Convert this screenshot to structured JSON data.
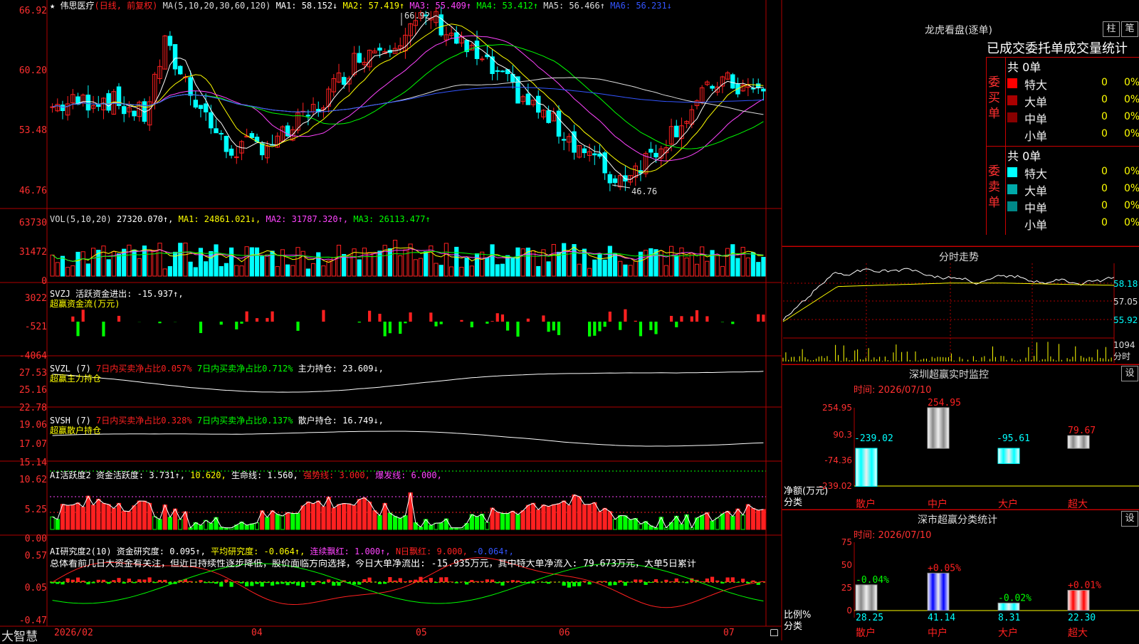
{
  "app": {
    "brand": "大智慧"
  },
  "header": {
    "star": "★",
    "stock": "伟思医疗",
    "mode": "(日线, 前复权)",
    "ma_label": "MA(5,10,20,30,60,120)",
    "ma": [
      {
        "t": "MA1: 58.152↓",
        "c": "#ffffff"
      },
      {
        "t": "MA2: 57.419↑",
        "c": "#ffff00"
      },
      {
        "t": "MA3: 55.409↑",
        "c": "#ff44ff"
      },
      {
        "t": "MA4: 53.412↑",
        "c": "#00ff00"
      },
      {
        "t": "MA5: 56.466↑",
        "c": "#dddddd"
      },
      {
        "t": "MA6: 56.231↓",
        "c": "#3355ff"
      }
    ]
  },
  "price_axis": [
    "66.92",
    "60.20",
    "53.48",
    "46.76"
  ],
  "price_annot": {
    "high": "66.92",
    "low": "46.76"
  },
  "vol": {
    "label": "VOL(5,10,20)",
    "val": "27320.070↑,",
    "ma1": "MA1: 24861.021↓,",
    "ma2": "MA2: 31787.320↑,",
    "ma3": "MA3: 26113.477↑",
    "axis": [
      "63730",
      "31472",
      "0"
    ]
  },
  "svzj": {
    "label": "SVZJ  活跃资金进出: -15.937↑,",
    "sub": "超赢资金流(万元)",
    "axis": [
      "3022",
      "-521",
      "-4064"
    ]
  },
  "svzl": {
    "label": "SVZL (7)",
    "p1": "7日内买卖净占比0.057%",
    "p2": "7日内买卖净占比0.712%",
    "p3": "主力持仓: 23.609↓,",
    "sub": "超赢主力持仓",
    "axis": [
      "27.53",
      "25.16",
      "22.78"
    ]
  },
  "svsh": {
    "label": "SVSH (7)",
    "p1": "7日内买卖净占比0.328%",
    "p2": "7日内买卖净占比0.137%",
    "p3": "散户持仓: 16.749↓,",
    "sub": "超赢散户持仓",
    "axis": [
      "19.06",
      "17.07",
      "15.14"
    ]
  },
  "ai1": {
    "label": "AI活跃度2 资金活跃度: 3.731↑,",
    "v2": "10.620,",
    "v3": "生命线: 1.560,",
    "v4": "强势线: 3.000,",
    "v5": "爆发线: 6.000,",
    "axis": [
      "10.62",
      "5.25",
      "0.00"
    ]
  },
  "ai2": {
    "label": "AI研究度2(10) 资金研究度: 0.095↑,",
    "v2": "平均研究度: -0.064↑,",
    "v3": "连续飘红: 1.000↑,",
    "v4": "N日飘红: 9.000,",
    "v5": "-0.064↑,",
    "text": "总体看前几日大资金有关注，但近日持续性逐步降低，股价面临方向选择，今日大单净流出: -15.935万元，其中特大单净流入: 79.673万元，大单5日累计",
    "axis": [
      "0.57",
      "0.05",
      "-0.47"
    ]
  },
  "dates": [
    "2026/02",
    "04",
    "05",
    "06",
    "07"
  ],
  "lhb": {
    "title": "龙虎看盘(逐单)",
    "btn1": "柱",
    "btn2": "笔",
    "subtitle": "已成交委托单成交量统计",
    "buy": {
      "side": "委买单",
      "total": "共 0单",
      "rows": [
        {
          "k": "特大",
          "v": "0",
          "p": "0%",
          "c": "#ff0000"
        },
        {
          "k": "大单",
          "v": "0",
          "p": "0%",
          "c": "#aa0000"
        },
        {
          "k": "中单",
          "v": "0",
          "p": "0%",
          "c": "#880000"
        },
        {
          "k": "小单",
          "v": "0",
          "p": "0%",
          "c": "#000000"
        }
      ]
    },
    "sell": {
      "side": "委卖单",
      "total": "共 0单",
      "rows": [
        {
          "k": "特大",
          "v": "0",
          "p": "0%",
          "c": "#00ffff"
        },
        {
          "k": "大单",
          "v": "0",
          "p": "0%",
          "c": "#00aaaa"
        },
        {
          "k": "中单",
          "v": "0",
          "p": "0%",
          "c": "#008888"
        },
        {
          "k": "小单",
          "v": "0",
          "p": "0%",
          "c": "#000000"
        }
      ]
    }
  },
  "intraday": {
    "title": "分时走势",
    "axis": [
      "58.18",
      "57.05",
      "55.92"
    ],
    "vol": "1094",
    "vol_label": "分时"
  },
  "sz_monitor": {
    "title": "深圳超赢实时监控",
    "btn": "设",
    "time": "时间: 2026/07/10",
    "axis": [
      "254.95",
      "90.3",
      "-74.36",
      "-239.02"
    ],
    "unit": "净额(万元)",
    "cls": "分类",
    "bars": [
      {
        "name": "散户",
        "val": "-239.02"
      },
      {
        "name": "中户",
        "val": "254.95"
      },
      {
        "name": "大户",
        "val": "-95.61"
      },
      {
        "name": "超大",
        "val": "79.67"
      }
    ]
  },
  "sz_stats": {
    "title": "深市超赢分类统计",
    "btn": "设",
    "time": "时间: 2026/07/10",
    "axis": [
      "75",
      "50",
      "25",
      "0"
    ],
    "unit": "比例%",
    "cls": "分类",
    "bars": [
      {
        "name": "散户",
        "val": "28.25",
        "chg": "-0.04%"
      },
      {
        "name": "中户",
        "val": "41.14",
        "chg": "+0.05%"
      },
      {
        "name": "大户",
        "val": "8.31",
        "chg": "-0.02%"
      },
      {
        "name": "超大",
        "val": "22.30",
        "chg": "+0.01%"
      }
    ]
  },
  "colors": {
    "up": "#ff2020",
    "down": "#00ffff",
    "grid": "#b00000",
    "axis": "#ff3030"
  }
}
